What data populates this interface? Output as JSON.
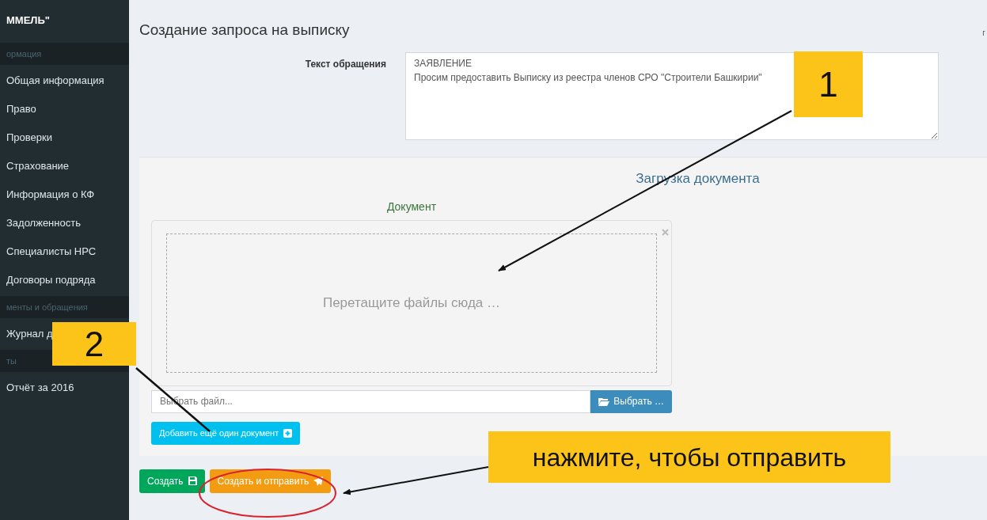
{
  "sidebar": {
    "brand": "ММЕЛЬ\"",
    "items": [
      {
        "kind": "header",
        "label": "ормация"
      },
      {
        "kind": "item",
        "label": "Общая информация"
      },
      {
        "kind": "item",
        "label": "Право"
      },
      {
        "kind": "item",
        "label": "Проверки"
      },
      {
        "kind": "item",
        "label": "Страхование"
      },
      {
        "kind": "item",
        "label": "Информация о КФ"
      },
      {
        "kind": "item",
        "label": "Задолженность"
      },
      {
        "kind": "item",
        "label": "Специалисты НРС"
      },
      {
        "kind": "item",
        "label": "Договоры подряда"
      },
      {
        "kind": "header",
        "label": "менты и обращения"
      },
      {
        "kind": "item",
        "label": "Журнал д"
      },
      {
        "kind": "header",
        "label": "ты"
      },
      {
        "kind": "item",
        "label": "Отчёт за 2016"
      }
    ]
  },
  "page": {
    "title": "Создание запроса на выписку",
    "corner_text": "г"
  },
  "form": {
    "label": "Текст обращения",
    "value": "ЗАЯВЛЕНИЕ\nПросим предоставить Выписку из реестра членов СРО \"Строители Башкирии\""
  },
  "upload": {
    "title": "Загрузка документа",
    "document_label": "Документ",
    "drop_text": "Перетащите файлы сюда …",
    "file_placeholder": "Выбрать файл...",
    "browse_button": "Выбрать …",
    "add_button": "Добавить ещё один документ"
  },
  "actions": [
    {
      "kind": "create",
      "label": "Создать"
    },
    {
      "kind": "send",
      "label": "Создать и отправить"
    }
  ],
  "annotations": [
    {
      "kind": "number",
      "text": "1"
    },
    {
      "kind": "number",
      "text": "2"
    },
    {
      "kind": "hint",
      "text": "нажмите, чтобы отправить"
    }
  ]
}
